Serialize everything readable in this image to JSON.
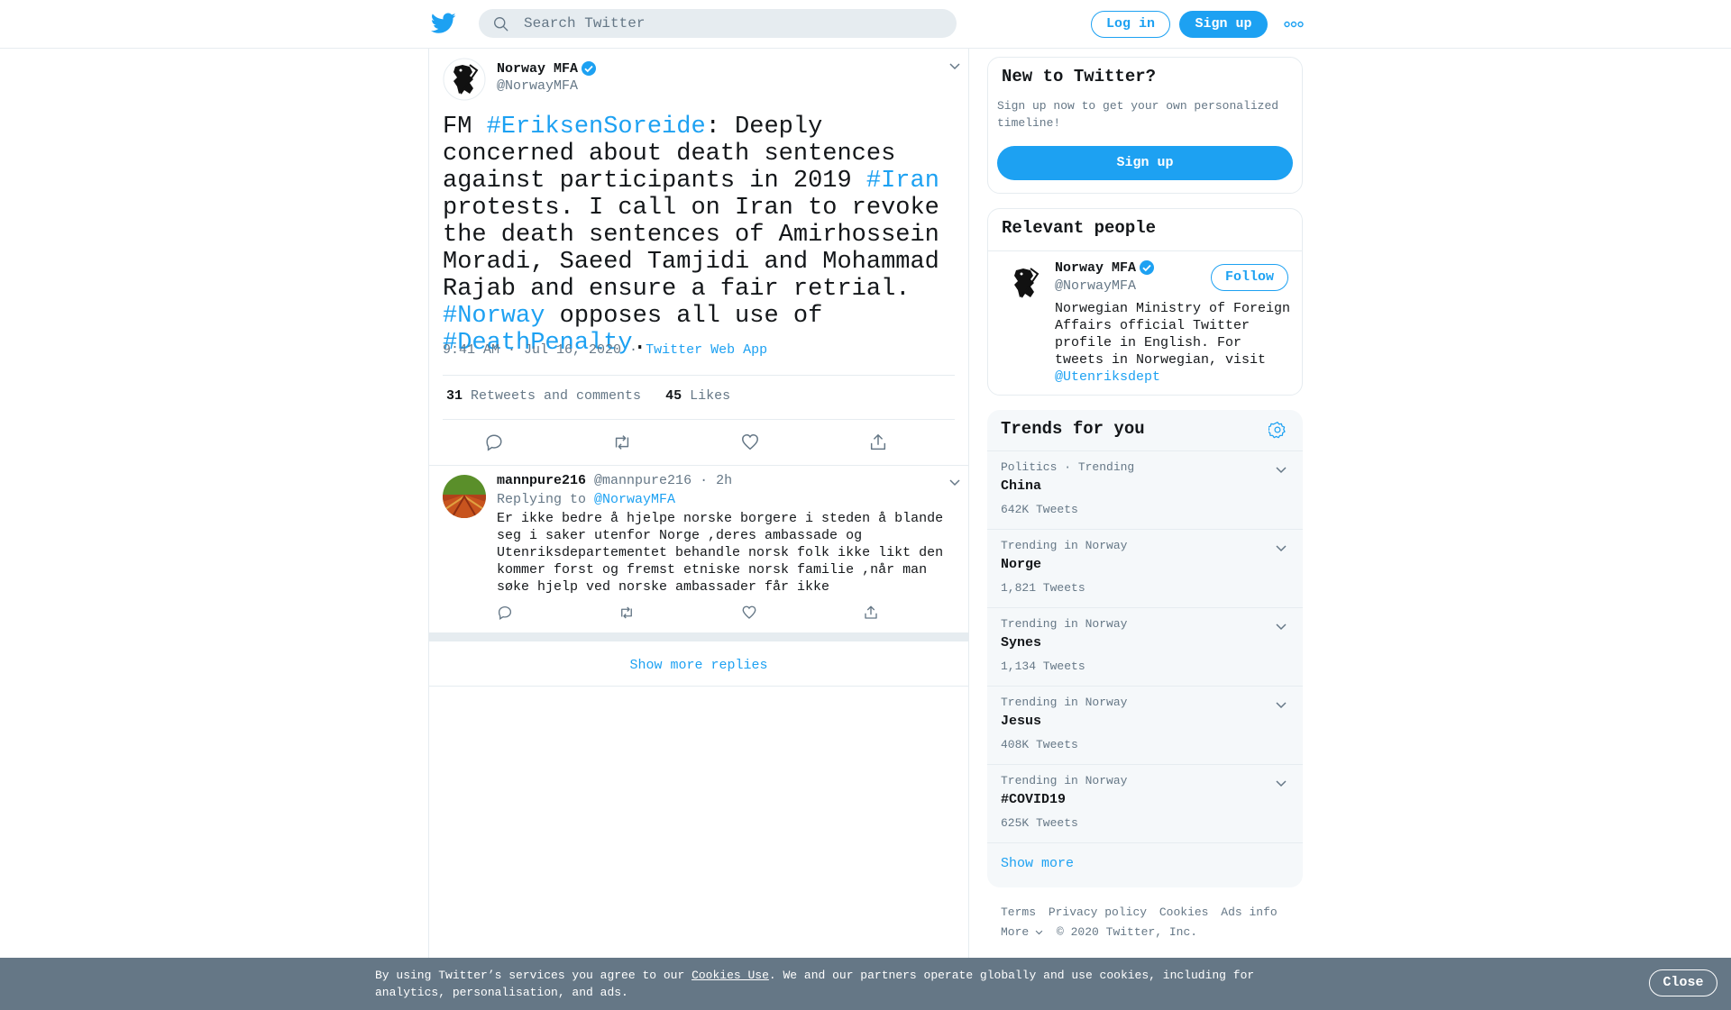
{
  "header": {
    "search_placeholder": "Search Twitter",
    "login_label": "Log in",
    "signup_label": "Sign up"
  },
  "tweet": {
    "author_name": "Norway MFA",
    "author_handle": "@NorwayMFA",
    "text_parts": [
      {
        "t": "FM ",
        "link": false
      },
      {
        "t": "#EriksenSoreide",
        "link": true
      },
      {
        "t": ": Deeply concerned about death sentences against participants in 2019 ",
        "link": false
      },
      {
        "t": "#Iran",
        "link": true
      },
      {
        "t": " protests. I call on Iran to revoke the death sentences of Amirhossein Moradi, Saeed Tamjidi and Mohammad Rajab and ensure a fair retrial. ",
        "link": false
      },
      {
        "t": "#Norway",
        "link": true
      },
      {
        "t": " opposes all use of ",
        "link": false
      },
      {
        "t": "#DeathPenalty",
        "link": true
      },
      {
        "t": ".",
        "link": false
      }
    ],
    "time": "9:41 AM · Jul 16, 2020",
    "source": "Twitter Web App",
    "retweets_count": "31",
    "retweets_label": "Retweets and comments",
    "likes_count": "45",
    "likes_label": "Likes"
  },
  "reply": {
    "author_name": "mannpure216",
    "author_handle": "@mannpure216",
    "age": "· 2h",
    "replying_prefix": "Replying to",
    "replying_to": "@NorwayMFA",
    "text": "Er ikke bedre å hjelpe norske borgere i steden å blande seg i saker utenfor Norge ,deres ambassade og Utenriksdepartementet behandle norsk folk ikke likt den kommer forst og fremst etniske norsk familie ,når man søke hjelp ved norske ambassader får ikke"
  },
  "show_more_replies": "Show more replies",
  "new_to_twitter": {
    "title": "New to Twitter?",
    "subtitle": "Sign up now to get your own personalized timeline!",
    "button": "Sign up"
  },
  "relevant_people": {
    "title": "Relevant people",
    "name": "Norway MFA",
    "handle": "@NorwayMFA",
    "follow_label": "Follow",
    "bio": "Norwegian Ministry of Foreign Affairs official Twitter profile in English. For tweets in Norwegian, visit",
    "bio_link": "@Utenriksdept"
  },
  "trends": {
    "title": "Trends for you",
    "items": [
      {
        "category": "Politics · Trending",
        "name": "China",
        "count": "642K Tweets"
      },
      {
        "category": "Trending in Norway",
        "name": "Norge",
        "count": "1,821 Tweets"
      },
      {
        "category": "Trending in Norway",
        "name": "Synes",
        "count": "1,134 Tweets"
      },
      {
        "category": "Trending in Norway",
        "name": "Jesus",
        "count": "408K Tweets"
      },
      {
        "category": "Trending in Norway",
        "name": "#COVID19",
        "count": "625K Tweets"
      }
    ],
    "show_more": "Show more"
  },
  "footer": {
    "links": [
      "Terms",
      "Privacy policy",
      "Cookies",
      "Ads info"
    ],
    "more": "More",
    "copyright": "© 2020 Twitter, Inc."
  },
  "cookie_bar": {
    "text_before": "By using Twitter’s services you agree to our ",
    "link": "Cookies Use",
    "text_after": ". We and our partners operate globally and use cookies, including for analytics, personalisation, and ads.",
    "close_label": "Close"
  },
  "colors": {
    "accent": "#1da1f2",
    "text": "#14171a",
    "muted": "#657786",
    "border": "#e6ecf0",
    "cookie_bg": "#657786"
  }
}
